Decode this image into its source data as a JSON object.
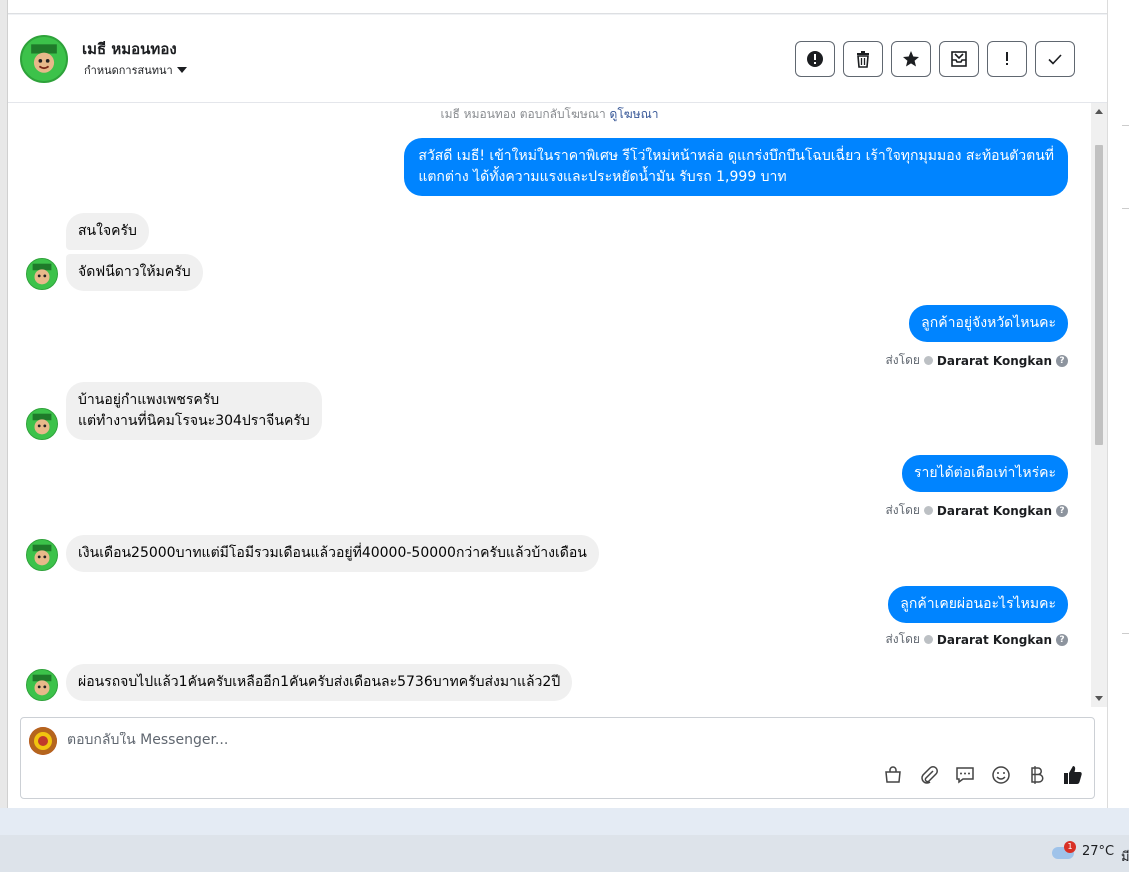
{
  "contact": {
    "name": "เมธี หมอนทอง",
    "settings_label": "กำหนดการสนทนา"
  },
  "actions": [
    {
      "name": "report-button",
      "icon": "alert-circle-icon"
    },
    {
      "name": "delete-button",
      "icon": "trash-icon"
    },
    {
      "name": "star-button",
      "icon": "star-icon"
    },
    {
      "name": "archive-button",
      "icon": "archive-icon"
    },
    {
      "name": "mark-important-button",
      "icon": "exclamation-icon"
    },
    {
      "name": "mark-done-button",
      "icon": "check-icon"
    }
  ],
  "thread": {
    "ad_reply_text": "เมธี หมอนทอง ตอบกลับโฆษณา",
    "ad_link": "ดูโฆษณา",
    "messages": [
      {
        "dir": "out",
        "text": "สวัสดี เมธี! เข้าใหม่ในราคาพิเศษ รีโว่ใหม่หน้าหล่อ ดูแกร่งบึกบึนโฉบเฉี่ยว เร้าใจทุกมุมมอง สะท้อนตัวตนที่\nแตกต่าง ได้ทั้งความแรงและประหยัดน้ำมัน รับรถ 1,999 บาท"
      },
      {
        "dir": "in",
        "text": "สนใจครับ"
      },
      {
        "dir": "in",
        "text": "จัดฟนีดาวให้มครับ"
      },
      {
        "dir": "out",
        "text": "ลูกค้าอยู่จังหวัดไหนคะ"
      },
      {
        "dir": "in",
        "text": "บ้านอยู่กำแพงเพชรครับ\nแต่ทำงานที่นิคมโรจนะ304ปราจีนครับ"
      },
      {
        "dir": "out",
        "text": "รายได้ต่อเดือเท่าไหร่คะ"
      },
      {
        "dir": "in",
        "text": "เงินเดือน25000บาทแต่มีโอมีรวมเดือนแล้วอยู่ที่40000-50000กว่าครับแล้วบ้างเดือน"
      },
      {
        "dir": "out",
        "text": "ลูกค้าเคยผ่อนอะไรไหมคะ"
      },
      {
        "dir": "in",
        "text": "ผ่อนรถจบไปแล้ว1คันครับเหลืออีก1คันครับส่งเดือนละ5736บาทครับส่งมาแล้ว2ปี"
      }
    ],
    "sent_by_label": "ส่งโดย",
    "sender_name": "Dararat Kongkan",
    "help_glyph": "?"
  },
  "composer": {
    "placeholder": "ตอบกลับใน Messenger...",
    "tools": [
      "shop-icon",
      "attach-icon",
      "saved-reply-icon",
      "emoji-icon",
      "baht-icon",
      "like-icon"
    ]
  },
  "taskbar": {
    "temperature": "27°C",
    "notification_count": "1",
    "date_fragment": "มี"
  }
}
